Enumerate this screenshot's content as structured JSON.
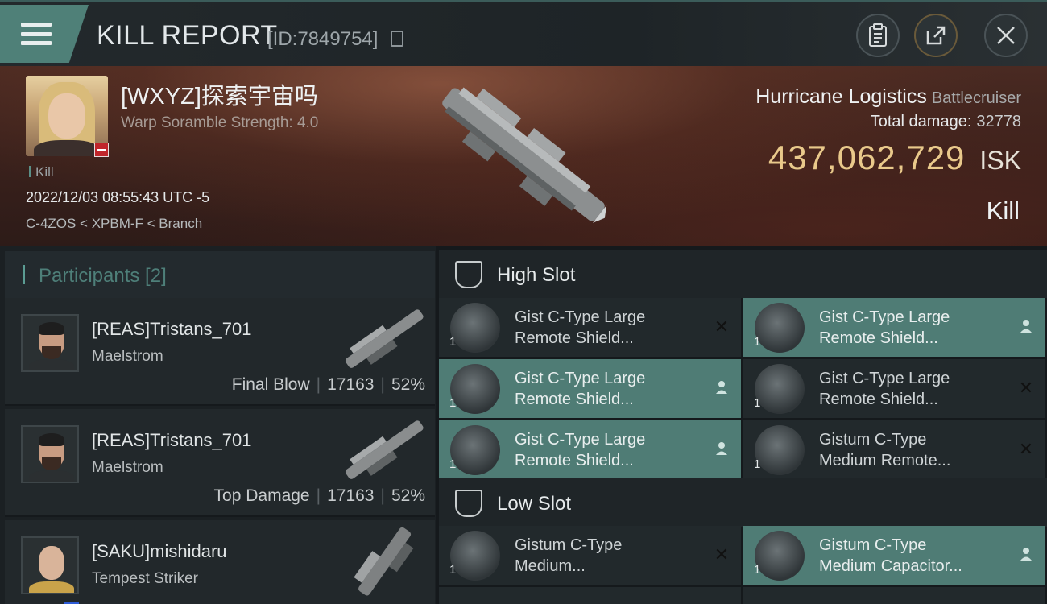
{
  "header": {
    "title": "KILL REPORT",
    "id_text": "[ID:7849754]"
  },
  "victim": {
    "pilot_name": "[WXYZ]探索宇宙吗",
    "scramble": "Warp Soramble Strength: 4.0",
    "kill_tag": "Kill",
    "datetime": "2022/12/03 08:55:43 UTC -5",
    "location": "C-4ZOS < XPBM-F < Branch",
    "ship_name": "Hurricane Logistics",
    "ship_class": "Battlecruiser",
    "total_damage_label": "Total damage:",
    "total_damage": "32778",
    "isk_value": "437,062,729",
    "isk_unit": "ISK",
    "result": "Kill"
  },
  "participants": {
    "label": "Participants [2]",
    "rows": [
      {
        "name": "[REAS]Tristans_701",
        "ship": "Maelstrom",
        "tag": "Final Blow",
        "damage": "17163",
        "percent": "52%"
      },
      {
        "name": "[REAS]Tristans_701",
        "ship": "Maelstrom",
        "tag": "Top Damage",
        "damage": "17163",
        "percent": "52%"
      },
      {
        "name": "[SAKU]mishidaru",
        "ship": "Tempest Striker",
        "tag": "",
        "damage": "",
        "percent": ""
      }
    ]
  },
  "high_slot": {
    "label": "High Slot",
    "items": [
      {
        "qty": "1",
        "line1": "Gist C-Type Large",
        "line2": "Remote Shield...",
        "state": "destroyed"
      },
      {
        "qty": "1",
        "line1": "Gist C-Type Large",
        "line2": "Remote Shield...",
        "state": "dropped"
      },
      {
        "qty": "1",
        "line1": "Gist C-Type Large",
        "line2": "Remote Shield...",
        "state": "dropped"
      },
      {
        "qty": "1",
        "line1": "Gist C-Type Large",
        "line2": "Remote Shield...",
        "state": "destroyed"
      },
      {
        "qty": "1",
        "line1": "Gist C-Type Large",
        "line2": "Remote Shield...",
        "state": "dropped"
      },
      {
        "qty": "1",
        "line1": "Gistum C-Type",
        "line2": "Medium Remote...",
        "state": "destroyed"
      }
    ]
  },
  "low_slot": {
    "label": "Low Slot",
    "items": [
      {
        "qty": "1",
        "line1": "Gistum C-Type",
        "line2": "Medium...",
        "state": "destroyed"
      },
      {
        "qty": "1",
        "line1": "Gistum C-Type",
        "line2": "Medium Capacitor...",
        "state": "dropped"
      }
    ]
  },
  "icons": {
    "menu": "menu-icon",
    "copy": "copy-icon",
    "clipboard": "clipboard-icon",
    "share": "share-icon",
    "close": "close-icon",
    "destroyed": "x-mark-icon",
    "dropped": "person-icon",
    "slot": "slot-icon"
  },
  "colors": {
    "accent": "#4f7c75",
    "isk": "#e9c98b",
    "victim_badge": "#c0262b",
    "participant_header": "#4e7f79"
  }
}
